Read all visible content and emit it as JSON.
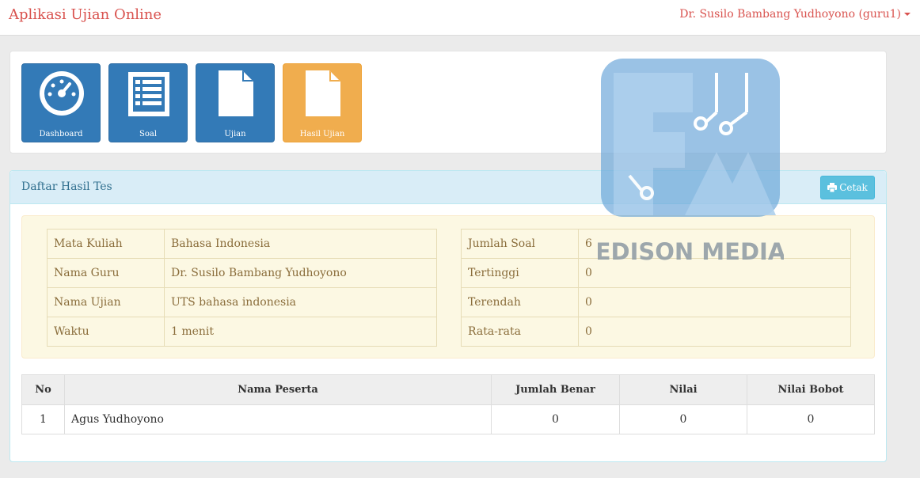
{
  "navbar": {
    "brand": "Aplikasi Ujian Online",
    "user": "Dr. Susilo Bambang Yudhoyono (guru1)"
  },
  "tiles": [
    {
      "label": "Dashboard",
      "icon": "dashboard-icon",
      "color": "#337ab7"
    },
    {
      "label": "Soal",
      "icon": "list-icon",
      "color": "#337ab7"
    },
    {
      "label": "Ujian",
      "icon": "file-icon",
      "color": "#337ab7"
    },
    {
      "label": "Hasil Ujian",
      "icon": "file-icon",
      "color": "#f0ad4e"
    }
  ],
  "panel": {
    "title": "Daftar Hasil Tes",
    "print_button": "Cetak"
  },
  "info_left": [
    {
      "label": "Mata Kuliah",
      "value": "Bahasa Indonesia"
    },
    {
      "label": "Nama Guru",
      "value": "Dr. Susilo Bambang Yudhoyono"
    },
    {
      "label": "Nama Ujian",
      "value": "UTS bahasa indonesia"
    },
    {
      "label": "Waktu",
      "value": "1 menit"
    }
  ],
  "info_right": [
    {
      "label": "Jumlah Soal",
      "value": "6"
    },
    {
      "label": "Tertinggi",
      "value": "0"
    },
    {
      "label": "Terendah",
      "value": "0"
    },
    {
      "label": "Rata-rata",
      "value": "0"
    }
  ],
  "results": {
    "headers": [
      "No",
      "Nama Peserta",
      "Jumlah Benar",
      "Nilai",
      "Nilai Bobot"
    ],
    "rows": [
      [
        "1",
        "Agus Yudhoyono",
        "0",
        "0",
        "0"
      ]
    ]
  },
  "watermark": {
    "text": "EDISON MEDIA"
  },
  "colors": {
    "brand_red": "#d9534f",
    "primary": "#337ab7",
    "warning": "#f0ad4e",
    "info": "#5bc0de",
    "panel_heading": "#d9edf7",
    "well": "#fcf8e3"
  }
}
